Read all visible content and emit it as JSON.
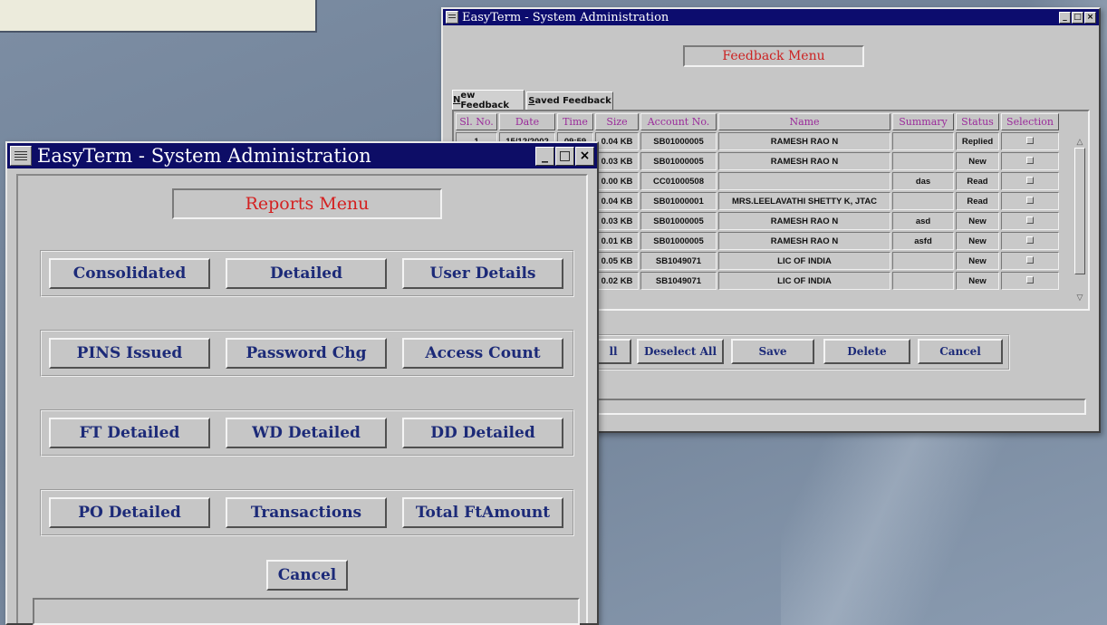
{
  "feedback_window": {
    "title": "EasyTerm - System Administration",
    "menu_title": "Feedback Menu",
    "tabs": [
      {
        "label_u": "N",
        "label_rest": "ew Feedback",
        "active": true
      },
      {
        "label_u": "S",
        "label_rest": "aved Feedback",
        "active": false
      }
    ],
    "columns": [
      "Sl. No.",
      "Date",
      "Time",
      "Size",
      "Account No.",
      "Name",
      "Summary",
      "Status",
      "Selection"
    ],
    "rows": [
      {
        "sl": "1",
        "date": "15/12/2002",
        "time": "09:59",
        "size": "0.04 KB",
        "account": "SB01000005",
        "name": "RAMESH RAO N",
        "summary": "",
        "status": "Replied"
      },
      {
        "sl": "",
        "date": "",
        "time": "",
        "size": "0.03 KB",
        "account": "SB01000005",
        "name": "RAMESH RAO N",
        "summary": "",
        "status": "New"
      },
      {
        "sl": "",
        "date": "",
        "time": "",
        "size": "0.00 KB",
        "account": "CC01000508",
        "name": "",
        "summary": "das",
        "status": "Read"
      },
      {
        "sl": "",
        "date": "",
        "time": "",
        "size": "0.04 KB",
        "account": "SB01000001",
        "name": "MRS.LEELAVATHI SHETTY K, JTAC",
        "summary": "",
        "status": "Read"
      },
      {
        "sl": "",
        "date": "",
        "time": "",
        "size": "0.03 KB",
        "account": "SB01000005",
        "name": "RAMESH RAO N",
        "summary": "asd",
        "status": "New"
      },
      {
        "sl": "",
        "date": "",
        "time": "",
        "size": "0.01 KB",
        "account": "SB01000005",
        "name": "RAMESH RAO N",
        "summary": "asfd",
        "status": "New"
      },
      {
        "sl": "",
        "date": "",
        "time": "",
        "size": "0.05 KB",
        "account": "SB1049071",
        "name": "LIC OF INDIA",
        "summary": "",
        "status": "New"
      },
      {
        "sl": "",
        "date": "",
        "time": "",
        "size": "0.02 KB",
        "account": "SB1049071",
        "name": "LIC OF INDIA",
        "summary": "",
        "status": "New"
      }
    ],
    "buttons": {
      "select_all_partial": "ll",
      "deselect_all": "Deselect All",
      "save": "Save",
      "delete": "Delete",
      "cancel": "Cancel"
    }
  },
  "reports_window": {
    "title": "EasyTerm - System Administration",
    "menu_title": "Reports Menu",
    "groups": [
      [
        "Consolidated",
        "Detailed",
        "User Details"
      ],
      [
        "PINS Issued",
        "Password Chg",
        "Access Count"
      ],
      [
        "FT Detailed",
        "WD Detailed",
        "DD Detailed"
      ],
      [
        "PO Detailed",
        "Transactions",
        "Total FtAmount"
      ]
    ],
    "cancel": "Cancel"
  },
  "window_controls": {
    "minimize": "_",
    "maximize": "□",
    "close": "×"
  },
  "colors": {
    "titlebar": "#0c0c6e",
    "window_bg": "#c6c6c6",
    "menu_title": "#cc2222",
    "button_text": "#1c2a78",
    "column_header": "#9a2a9a"
  }
}
